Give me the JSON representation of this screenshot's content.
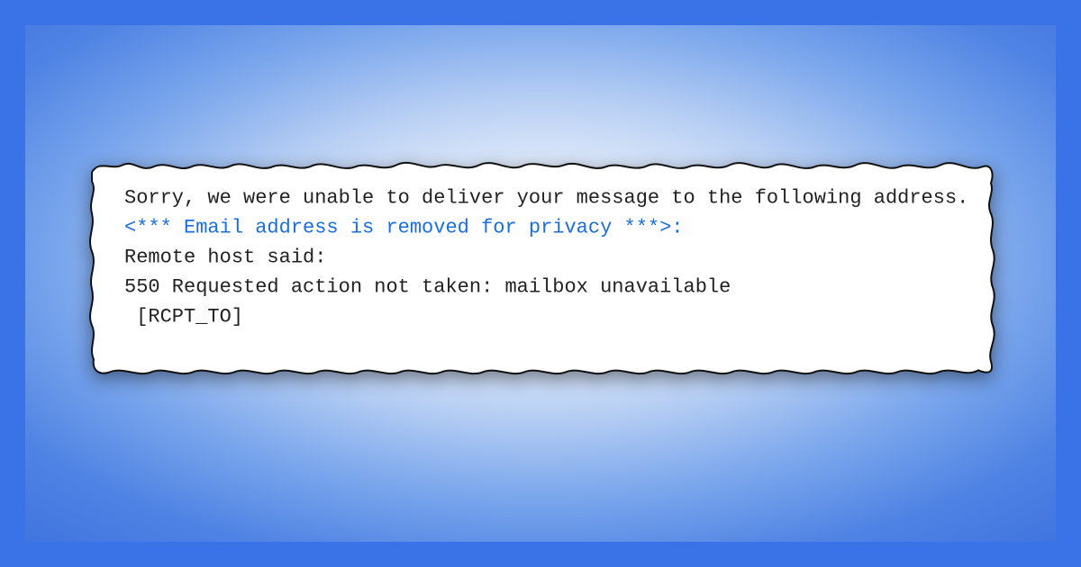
{
  "message": {
    "line1": "Sorry, we were unable to deliver your message to the following address.",
    "redacted": "<*** Email address is removed for privacy ***>:",
    "line3": "Remote host said:",
    "line4": "550 Requested action not taken: mailbox unavailable",
    "line5": "[RCPT_TO]"
  },
  "colors": {
    "frame": "#3a72e8",
    "link": "#1a6ee0"
  }
}
